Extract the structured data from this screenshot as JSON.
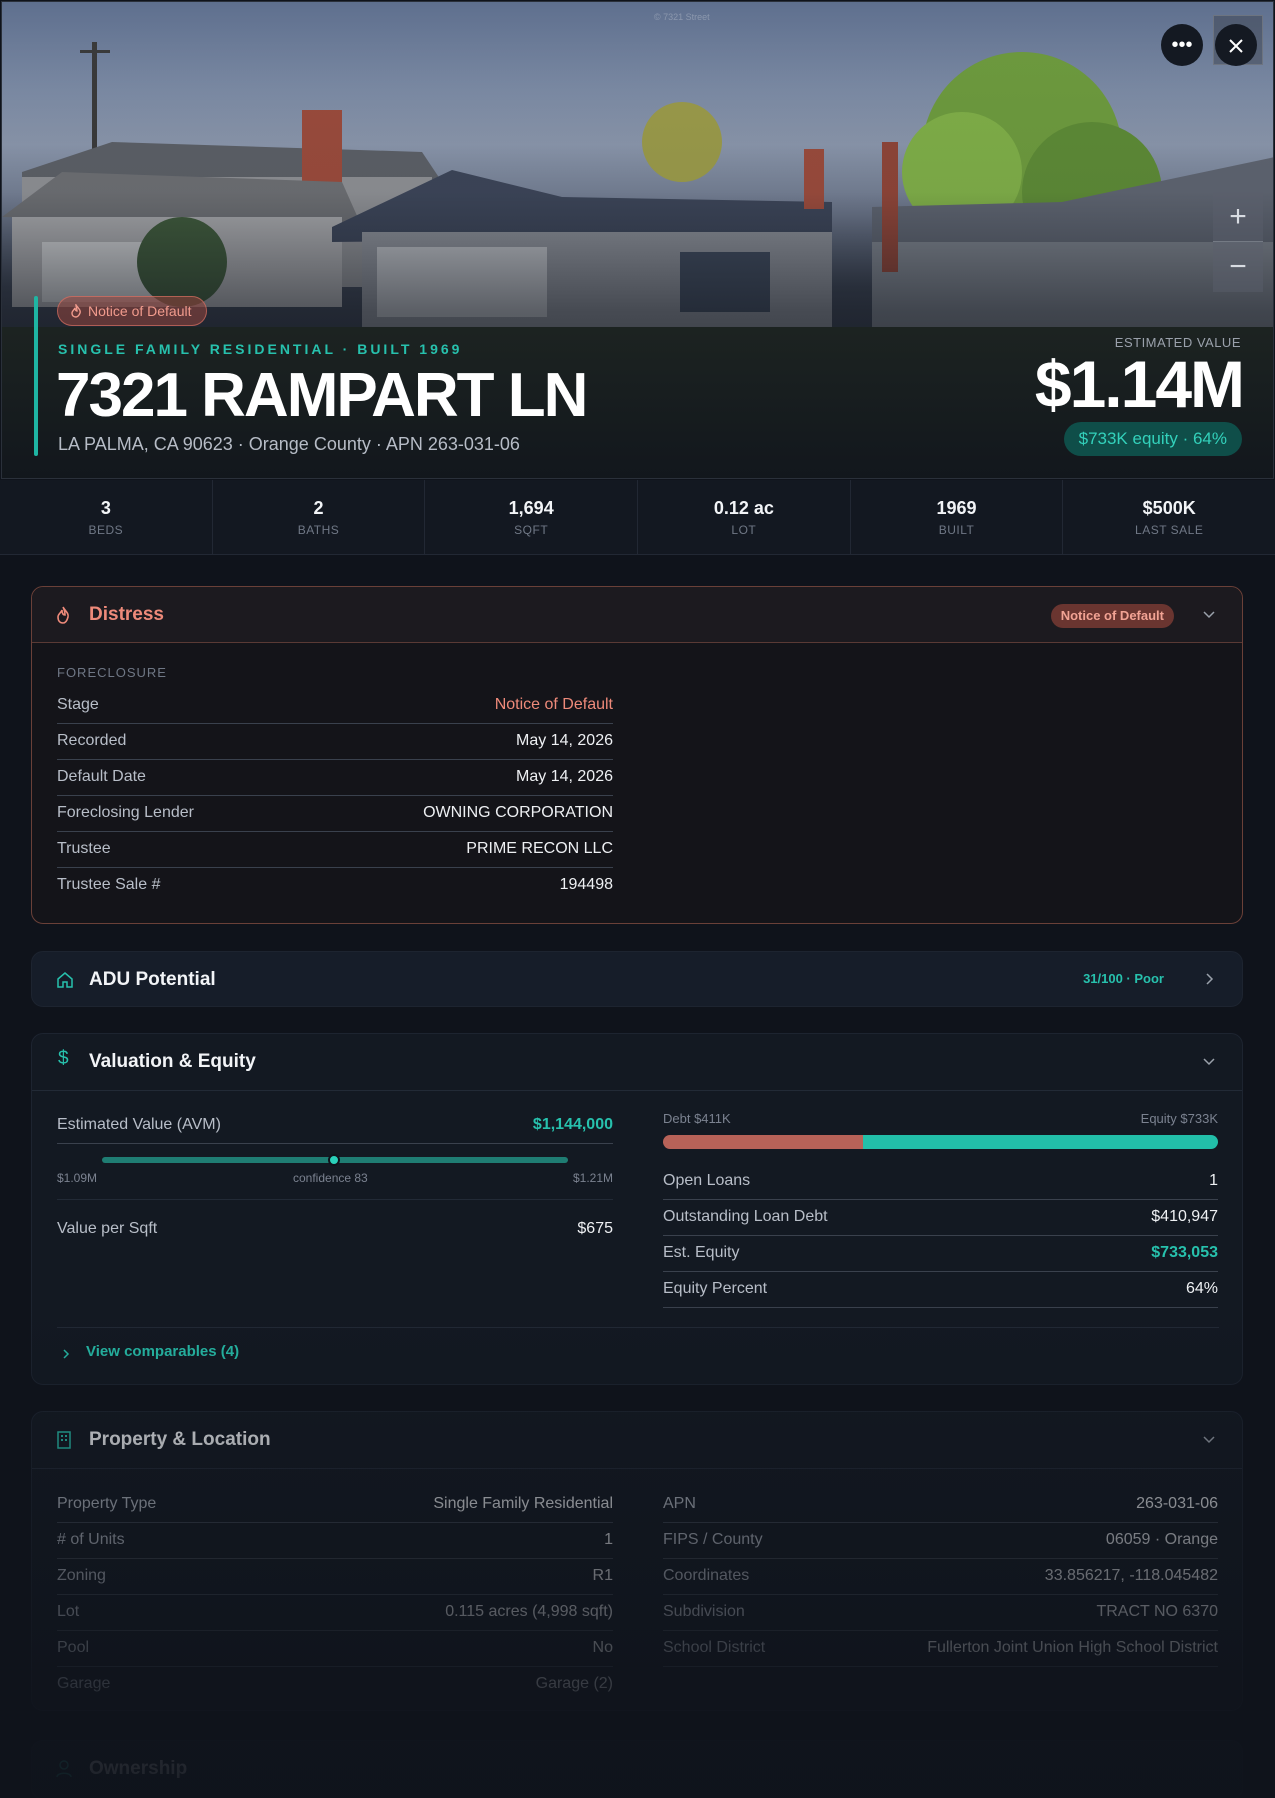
{
  "hero": {
    "watermark": "© 7321 Street",
    "distress_chip": "Notice of Default",
    "kicker": "SINGLE FAMILY RESIDENTIAL · BUILT 1969",
    "address": "7321 RAMPART LN",
    "subline": "LA PALMA, CA 90623 · Orange County · APN 263-031-06",
    "estimated_value_label": "ESTIMATED VALUE",
    "estimated_value": "$1.14M",
    "equity_chip": "$733K equity · 64%",
    "more_icon": "more-icon",
    "close_icon": "close-icon",
    "zoom_in": "+",
    "zoom_out": "−"
  },
  "stats": [
    {
      "value": "3",
      "label": "BEDS"
    },
    {
      "value": "2",
      "label": "BATHS"
    },
    {
      "value": "1,694",
      "label": "SQFT"
    },
    {
      "value": "0.12 ac",
      "label": "LOT"
    },
    {
      "value": "1969",
      "label": "BUILT"
    },
    {
      "value": "$500K",
      "label": "LAST SALE"
    }
  ],
  "distress": {
    "title": "Distress",
    "badge": "Notice of Default",
    "section": "FORECLOSURE",
    "rows": [
      {
        "k": "Stage",
        "v": "Notice of Default"
      },
      {
        "k": "Recorded",
        "v": "May 14, 2026"
      },
      {
        "k": "Default Date",
        "v": "May 14, 2026"
      },
      {
        "k": "Foreclosing Lender",
        "v": "OWNING CORPORATION"
      },
      {
        "k": "Trustee",
        "v": "PRIME RECON LLC"
      },
      {
        "k": "Trustee Sale #",
        "v": "194498"
      }
    ]
  },
  "adu": {
    "title": "ADU Potential",
    "score": "31/100 · Poor"
  },
  "valuation": {
    "title": "Valuation & Equity",
    "avm_label": "Estimated Value (AVM)",
    "avm_value": "$1,144,000",
    "range_low": "$1.09M",
    "confidence": "confidence 83",
    "range_high": "$1.21M",
    "ppsf_label": "Value per Sqft",
    "ppsf_value": "$675",
    "debt_label": "Debt $411K",
    "equity_label": "Equity $733K",
    "debt_fraction": 0.36,
    "rows": [
      {
        "k": "Open Loans",
        "v": "1"
      },
      {
        "k": "Outstanding Loan Debt",
        "v": "$410,947"
      },
      {
        "k": "Est. Equity",
        "v": "$733,053"
      },
      {
        "k": "Equity Percent",
        "v": "64%"
      }
    ],
    "comparables_link": "View comparables (4)"
  },
  "property": {
    "title": "Property & Location",
    "left": [
      {
        "k": "Property Type",
        "v": "Single Family Residential"
      },
      {
        "k": "# of Units",
        "v": "1"
      },
      {
        "k": "Zoning",
        "v": "R1"
      },
      {
        "k": "Lot",
        "v": "0.115 acres (4,998 sqft)"
      },
      {
        "k": "Pool",
        "v": "No"
      },
      {
        "k": "Garage",
        "v": "Garage (2)"
      }
    ],
    "right": [
      {
        "k": "APN",
        "v": "263-031-06"
      },
      {
        "k": "FIPS / County",
        "v": "06059 · Orange"
      },
      {
        "k": "Coordinates",
        "v": "33.856217, -118.045482"
      },
      {
        "k": "Subdivision",
        "v": "TRACT NO 6370"
      },
      {
        "k": "School District",
        "v": "Fullerton Joint Union High School District"
      }
    ]
  },
  "ownership": {
    "title": "Ownership"
  },
  "colors": {
    "accent": "#1fb5a3",
    "distress": "#ee8a7a",
    "debt": "#b76258",
    "equity": "#22bfa9"
  }
}
